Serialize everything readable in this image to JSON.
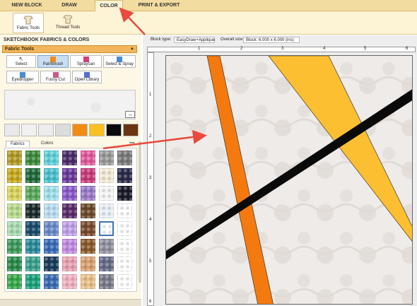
{
  "tabs": [
    {
      "label": "NEW BLOCK"
    },
    {
      "label": "DRAW"
    },
    {
      "label": "COLOR",
      "active": true
    },
    {
      "label": "PRINT & EXPORT"
    }
  ],
  "ribbon": {
    "fabric_tools": "Fabric Tools",
    "thread_tools": "Thread Tools"
  },
  "left_panel": {
    "title": "SKETCHBOOK FABRICS & COLORS",
    "fabric_tools_header": "Fabric Tools",
    "tools": [
      "Select",
      "Paintbrush",
      "Spraycan",
      "Select & Spray",
      "Eyedropper",
      "Fussy Cut",
      "Open Library"
    ],
    "subtabs": [
      "Fabrics",
      "Colors"
    ],
    "more_glyph": "▪▪▪"
  },
  "block_info": {
    "block_type_label": "Block type:",
    "block_type_value": "EasyDraw+Applique",
    "overall_size_label": "Overall size:",
    "overall_size_value": "Block: 6.000 x 6.000 (ins)"
  },
  "ruler": {
    "h_numbers": [
      "1",
      "2",
      "3",
      "4",
      "5",
      "6"
    ],
    "v_numbers": [
      "1",
      "2",
      "3",
      "4",
      "5",
      "6"
    ]
  },
  "colors": {
    "accent": "#f1b65c",
    "orange_strip": "#f47a0f",
    "yellow_strip": "#fcbf32",
    "black_strip": "#0a0a0a",
    "annotation_arrow": "#e84a3f"
  },
  "swatch_row": [
    "#e9e9e9",
    "#f1f1f1",
    "#ececec",
    "#dcdcdc",
    "#f38a12",
    "#f9c021",
    "#0b0b0b",
    "#6b3512"
  ],
  "fabric_grid": [
    [
      "#b09a24",
      "#3c8a3c",
      "#5fd0d8",
      "#4a2a6a",
      "#e05a9a",
      "#9a9a9a",
      "#7a7a7a"
    ],
    [
      "#c6a81e",
      "#1f6a3a",
      "#4ac0cf",
      "#6a3a9a",
      "#c83a7a",
      "#f3ead2",
      "#2a2a4a"
    ],
    [
      "#d7d35a",
      "#5aa75a",
      "#9fe0ea",
      "#8a5ac8",
      "#9a7ac8",
      "#f5f5f5",
      "#1a1a2a"
    ],
    [
      "#b8d98a",
      "#1a2a2a",
      "#b9dcef",
      "#5a2a6a",
      "#6a4a2a",
      "#e9eef5",
      "#fdfdfd"
    ],
    [
      "#a8dab0",
      "#1a4a6a",
      "#6a8ac8",
      "#c0a0e8",
      "#7a4a2a",
      "#ffffff",
      "#ffffff"
    ],
    [
      "#3a9a5a",
      "#2a8a9a",
      "#3a6ab8",
      "#c08ae0",
      "#8a5a2a",
      "#9090a0",
      "#ffffff"
    ],
    [
      "#2a8a4a",
      "#3aa08a",
      "#1a3a5a",
      "#e8a0b0",
      "#d8a070",
      "#6a6a8a",
      "#ffffff"
    ],
    [
      "#36a846",
      "#1aa07a",
      "#3a6ab0",
      "#f0b0c0",
      "#e8c088",
      "#7a7a8a",
      "#ffffff"
    ]
  ]
}
